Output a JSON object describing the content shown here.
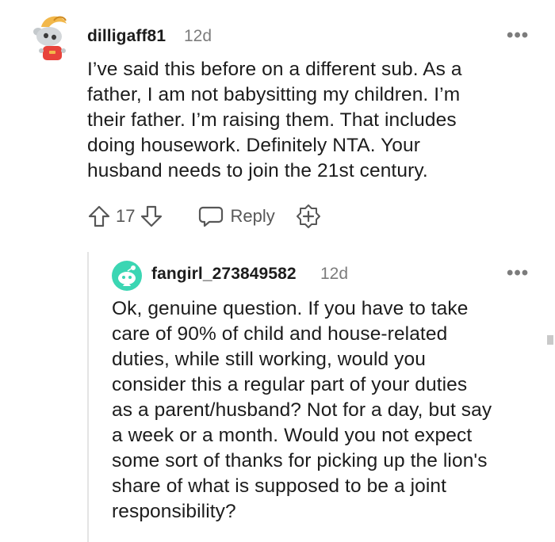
{
  "comments": [
    {
      "username": "dilligaff81",
      "age": "12d",
      "more_label": "•••",
      "body": "I’ve said this before on a different sub. As a father, I am not babysitting my children. I’m their father. I’m raising them. That includes doing housework. Definitely NTA. Your husband needs to join the 21st century.",
      "body_lines": [
        "I’ve said this before on a different sub. As a",
        "father, I am not babysitting my children. I’m",
        "their father. I’m raising them. That includes",
        "doing housework. Definitely NTA. Your",
        "husband needs to join the 21st century."
      ],
      "votes": "17",
      "reply_label": "Reply",
      "avatar_icon": "snoo-avatar-icon"
    },
    {
      "username": "fangirl_273849582",
      "age": "12d",
      "more_label": "•••",
      "body_lines": [
        "Ok, genuine question. If you have to take",
        "care of 90% of child and house-related",
        "duties, while still working, would you",
        "consider this a regular part of your duties",
        "as a parent/husband? Not for a day, but say",
        "a week or a month. Would you not expect",
        "some sort of thanks for picking up the lion's",
        "share of what is supposed to be a joint",
        "responsibility?"
      ],
      "avatar_icon": "default-snoo-avatar-icon"
    }
  ],
  "icons": {
    "upvote": "upvote-arrow-icon",
    "downvote": "downvote-arrow-icon",
    "reply": "speech-bubble-icon",
    "award": "award-plus-icon"
  },
  "colors": {
    "text": "#1c1c1c",
    "meta": "#7c7c7c",
    "action": "#575757",
    "avatar2_bg": "#3bd6b3"
  }
}
